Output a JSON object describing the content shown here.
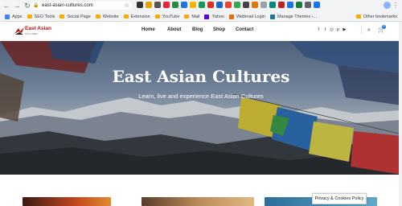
{
  "browser": {
    "url": "east-asian-cultures.com",
    "bookmarks": [
      "Apps",
      "SEO Tools",
      "Social Page",
      "Website",
      "Extension",
      "YouTube",
      "Mail",
      "Yahoo",
      "Webinail Login",
      "Manage Themes ‹..."
    ],
    "other_bookmarks": "Other bookmarks"
  },
  "site": {
    "logo_title": "East Asian",
    "logo_sub": "CULTURES",
    "nav": [
      "Home",
      "About",
      "Blog",
      "Shop",
      "Contact"
    ],
    "social_icons": [
      "facebook-icon",
      "twitter-icon",
      "instagram-icon",
      "pinterest-icon",
      "youtube-icon"
    ],
    "cart_count": "0"
  },
  "hero": {
    "title": "East Asian Cultures",
    "subtitle": "Learn, live and experience East Asian Cultures"
  },
  "cookie_button": "Privacy & Cookies Policy",
  "colors": {
    "brand_red": "#b11111",
    "accent_blue": "#1a73e8"
  }
}
